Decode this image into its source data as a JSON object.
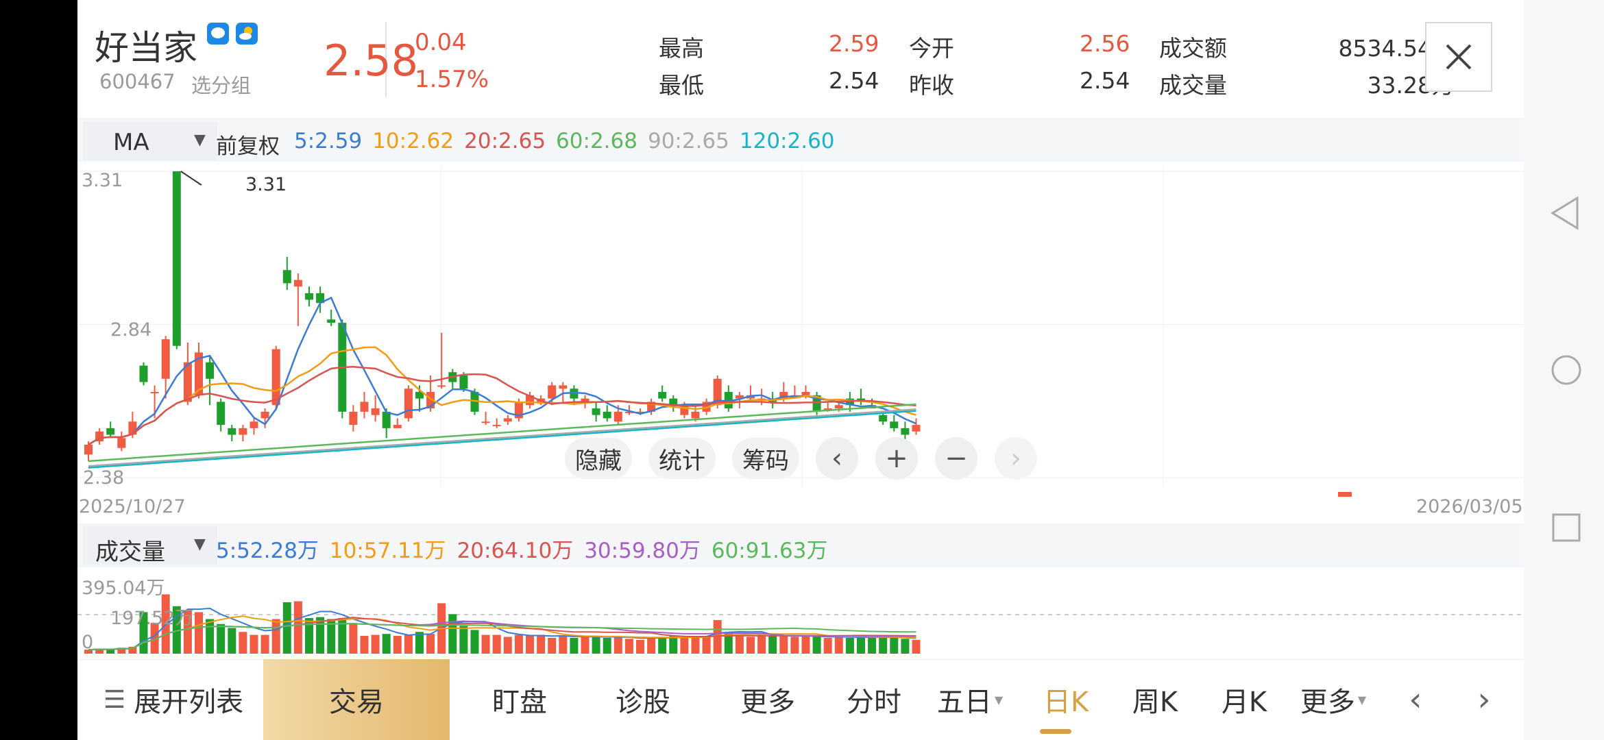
{
  "stock": {
    "name": "好当家",
    "code": "600467",
    "group_label": "选分组",
    "price": "2.58",
    "change": "0.04",
    "change_pct": "1.57%",
    "high_label": "最高",
    "high": "2.59",
    "low_label": "最低",
    "low": "2.54",
    "open_label": "今开",
    "open": "2.56",
    "prev_close_label": "昨收",
    "prev_close": "2.54",
    "amount_label": "成交额",
    "amount": "8534.54万",
    "volume_label": "成交量",
    "volume": "33.28万"
  },
  "ma_bar": {
    "selector": "MA",
    "adjust": "前复权",
    "items": [
      {
        "text": "5:2.59",
        "color": "#3a7bd5"
      },
      {
        "text": "10:2.62",
        "color": "#f39c12"
      },
      {
        "text": "20:2.65",
        "color": "#d9534f"
      },
      {
        "text": "60:2.68",
        "color": "#5cb85c"
      },
      {
        "text": "90:2.65",
        "color": "#aaaaaa"
      },
      {
        "text": "120:2.60",
        "color": "#17b5c8"
      }
    ]
  },
  "price_axis": {
    "top": "3.31",
    "mid": "2.84",
    "bottom": "2.38",
    "peak_label": "3.31"
  },
  "date_axis": {
    "start": "2025/10/27",
    "end": "2026/03/05"
  },
  "chart_buttons": {
    "hide": "隐藏",
    "stats": "统计",
    "chips": "筹码"
  },
  "vol_bar": {
    "selector": "成交量",
    "items": [
      {
        "text": "5:52.28万",
        "color": "#3a7bd5"
      },
      {
        "text": "10:57.11万",
        "color": "#f39c12"
      },
      {
        "text": "20:64.10万",
        "color": "#d9534f"
      },
      {
        "text": "30:59.80万",
        "color": "#a55fc6"
      },
      {
        "text": "60:91.63万",
        "color": "#5cb85c"
      }
    ]
  },
  "vol_axis": {
    "top": "395.04万",
    "mid": "197.52万",
    "zero": "0"
  },
  "bottom_nav": {
    "list": "展开列表",
    "trade": "交易",
    "watch": "盯盘",
    "diagnose": "诊股",
    "more": "更多",
    "tabs": [
      "分时",
      "五日",
      "日K",
      "周K",
      "月K",
      "更多"
    ],
    "active": "日K"
  },
  "colors": {
    "up": "#f05b41",
    "down": "#1e9e2a",
    "accent": "#e5583f"
  },
  "chart_data": {
    "type": "candlestick",
    "ylim": [
      2.38,
      3.31
    ],
    "candles": [
      {
        "o": 2.45,
        "c": 2.48,
        "h": 2.49,
        "l": 2.43
      },
      {
        "o": 2.49,
        "c": 2.52,
        "h": 2.53,
        "l": 2.48
      },
      {
        "o": 2.53,
        "c": 2.51,
        "h": 2.55,
        "l": 2.5
      },
      {
        "o": 2.47,
        "c": 2.5,
        "h": 2.52,
        "l": 2.46
      },
      {
        "o": 2.51,
        "c": 2.55,
        "h": 2.58,
        "l": 2.5
      },
      {
        "o": 2.72,
        "c": 2.67,
        "h": 2.73,
        "l": 2.66
      },
      {
        "o": 2.64,
        "c": 2.64,
        "h": 2.66,
        "l": 2.56
      },
      {
        "o": 2.68,
        "c": 2.8,
        "h": 2.81,
        "l": 2.62
      },
      {
        "o": 3.31,
        "c": 2.78,
        "h": 3.31,
        "l": 2.77
      },
      {
        "o": 2.61,
        "c": 2.73,
        "h": 2.79,
        "l": 2.6
      },
      {
        "o": 2.63,
        "c": 2.76,
        "h": 2.79,
        "l": 2.62
      },
      {
        "o": 2.73,
        "c": 2.68,
        "h": 2.75,
        "l": 2.6
      },
      {
        "o": 2.61,
        "c": 2.54,
        "h": 2.62,
        "l": 2.52
      },
      {
        "o": 2.53,
        "c": 2.51,
        "h": 2.54,
        "l": 2.49
      },
      {
        "o": 2.51,
        "c": 2.53,
        "h": 2.54,
        "l": 2.49
      },
      {
        "o": 2.53,
        "c": 2.55,
        "h": 2.56,
        "l": 2.51
      },
      {
        "o": 2.56,
        "c": 2.58,
        "h": 2.59,
        "l": 2.53
      },
      {
        "o": 2.6,
        "c": 2.77,
        "h": 2.78,
        "l": 2.59
      },
      {
        "o": 3.01,
        "c": 2.97,
        "h": 3.05,
        "l": 2.95
      },
      {
        "o": 2.96,
        "c": 2.98,
        "h": 3.0,
        "l": 2.84
      },
      {
        "o": 2.94,
        "c": 2.92,
        "h": 2.96,
        "l": 2.9
      },
      {
        "o": 2.94,
        "c": 2.91,
        "h": 2.96,
        "l": 2.88
      },
      {
        "o": 2.86,
        "c": 2.85,
        "h": 2.89,
        "l": 2.84
      },
      {
        "o": 2.85,
        "c": 2.58,
        "h": 2.86,
        "l": 2.56
      },
      {
        "o": 2.54,
        "c": 2.58,
        "h": 2.6,
        "l": 2.52
      },
      {
        "o": 2.58,
        "c": 2.61,
        "h": 2.64,
        "l": 2.56
      },
      {
        "o": 2.57,
        "c": 2.59,
        "h": 2.63,
        "l": 2.55
      },
      {
        "o": 2.58,
        "c": 2.53,
        "h": 2.59,
        "l": 2.5
      },
      {
        "o": 2.53,
        "c": 2.54,
        "h": 2.56,
        "l": 2.53
      },
      {
        "o": 2.56,
        "c": 2.65,
        "h": 2.66,
        "l": 2.55
      },
      {
        "o": 2.64,
        "c": 2.62,
        "h": 2.66,
        "l": 2.58
      },
      {
        "o": 2.59,
        "c": 2.64,
        "h": 2.69,
        "l": 2.58
      },
      {
        "o": 2.66,
        "c": 2.66,
        "h": 2.82,
        "l": 2.65
      },
      {
        "o": 2.7,
        "c": 2.67,
        "h": 2.71,
        "l": 2.65
      },
      {
        "o": 2.69,
        "c": 2.65,
        "h": 2.7,
        "l": 2.64
      },
      {
        "o": 2.64,
        "c": 2.58,
        "h": 2.65,
        "l": 2.57
      },
      {
        "o": 2.55,
        "c": 2.55,
        "h": 2.58,
        "l": 2.54
      },
      {
        "o": 2.54,
        "c": 2.54,
        "h": 2.56,
        "l": 2.53
      },
      {
        "o": 2.55,
        "c": 2.56,
        "h": 2.57,
        "l": 2.54
      },
      {
        "o": 2.56,
        "c": 2.61,
        "h": 2.62,
        "l": 2.55
      },
      {
        "o": 2.6,
        "c": 2.63,
        "h": 2.64,
        "l": 2.59
      },
      {
        "o": 2.61,
        "c": 2.62,
        "h": 2.63,
        "l": 2.6
      },
      {
        "o": 2.62,
        "c": 2.66,
        "h": 2.67,
        "l": 2.6
      },
      {
        "o": 2.65,
        "c": 2.66,
        "h": 2.67,
        "l": 2.61
      },
      {
        "o": 2.65,
        "c": 2.62,
        "h": 2.66,
        "l": 2.6
      },
      {
        "o": 2.61,
        "c": 2.62,
        "h": 2.63,
        "l": 2.59
      },
      {
        "o": 2.59,
        "c": 2.57,
        "h": 2.61,
        "l": 2.55
      },
      {
        "o": 2.58,
        "c": 2.56,
        "h": 2.6,
        "l": 2.55
      },
      {
        "o": 2.55,
        "c": 2.58,
        "h": 2.6,
        "l": 2.54
      },
      {
        "o": 2.58,
        "c": 2.58,
        "h": 2.6,
        "l": 2.57
      },
      {
        "o": 2.58,
        "c": 2.58,
        "h": 2.59,
        "l": 2.57
      },
      {
        "o": 2.58,
        "c": 2.61,
        "h": 2.62,
        "l": 2.57
      },
      {
        "o": 2.64,
        "c": 2.62,
        "h": 2.66,
        "l": 2.61
      },
      {
        "o": 2.62,
        "c": 2.6,
        "h": 2.63,
        "l": 2.58
      },
      {
        "o": 2.57,
        "c": 2.6,
        "h": 2.61,
        "l": 2.56
      },
      {
        "o": 2.56,
        "c": 2.58,
        "h": 2.6,
        "l": 2.55
      },
      {
        "o": 2.58,
        "c": 2.61,
        "h": 2.62,
        "l": 2.57
      },
      {
        "o": 2.6,
        "c": 2.68,
        "h": 2.69,
        "l": 2.59
      },
      {
        "o": 2.64,
        "c": 2.59,
        "h": 2.66,
        "l": 2.58
      },
      {
        "o": 2.62,
        "c": 2.63,
        "h": 2.64,
        "l": 2.59
      },
      {
        "o": 2.62,
        "c": 2.63,
        "h": 2.66,
        "l": 2.61
      },
      {
        "o": 2.62,
        "c": 2.62,
        "h": 2.65,
        "l": 2.6
      },
      {
        "o": 2.62,
        "c": 2.61,
        "h": 2.64,
        "l": 2.59
      },
      {
        "o": 2.62,
        "c": 2.64,
        "h": 2.67,
        "l": 2.61
      },
      {
        "o": 2.63,
        "c": 2.63,
        "h": 2.66,
        "l": 2.62
      },
      {
        "o": 2.63,
        "c": 2.64,
        "h": 2.66,
        "l": 2.62
      },
      {
        "o": 2.63,
        "c": 2.58,
        "h": 2.64,
        "l": 2.57
      },
      {
        "o": 2.59,
        "c": 2.59,
        "h": 2.61,
        "l": 2.58
      },
      {
        "o": 2.59,
        "c": 2.6,
        "h": 2.61,
        "l": 2.58
      },
      {
        "o": 2.62,
        "c": 2.6,
        "h": 2.64,
        "l": 2.58
      },
      {
        "o": 2.62,
        "c": 2.61,
        "h": 2.65,
        "l": 2.6
      },
      {
        "o": 2.6,
        "c": 2.59,
        "h": 2.62,
        "l": 2.59
      },
      {
        "o": 2.57,
        "c": 2.55,
        "h": 2.58,
        "l": 2.54
      },
      {
        "o": 2.55,
        "c": 2.53,
        "h": 2.57,
        "l": 2.52
      },
      {
        "o": 2.53,
        "c": 2.51,
        "h": 2.55,
        "l": 2.49
      },
      {
        "o": 2.52,
        "c": 2.54,
        "h": 2.56,
        "l": 2.51
      }
    ],
    "volume_ylim": [
      0,
      395.04
    ],
    "volumes": [
      20,
      25,
      22,
      30,
      35,
      210,
      155,
      300,
      240,
      220,
      210,
      175,
      150,
      130,
      110,
      95,
      95,
      175,
      260,
      265,
      180,
      185,
      175,
      180,
      155,
      90,
      95,
      100,
      90,
      95,
      110,
      100,
      255,
      200,
      140,
      120,
      95,
      95,
      85,
      95,
      90,
      95,
      80,
      90,
      80,
      90,
      85,
      80,
      85,
      75,
      70,
      85,
      85,
      90,
      80,
      90,
      90,
      170,
      110,
      95,
      85,
      95,
      90,
      90,
      85,
      90,
      85,
      80,
      85,
      80,
      85,
      80,
      85,
      80,
      75,
      70
    ]
  }
}
